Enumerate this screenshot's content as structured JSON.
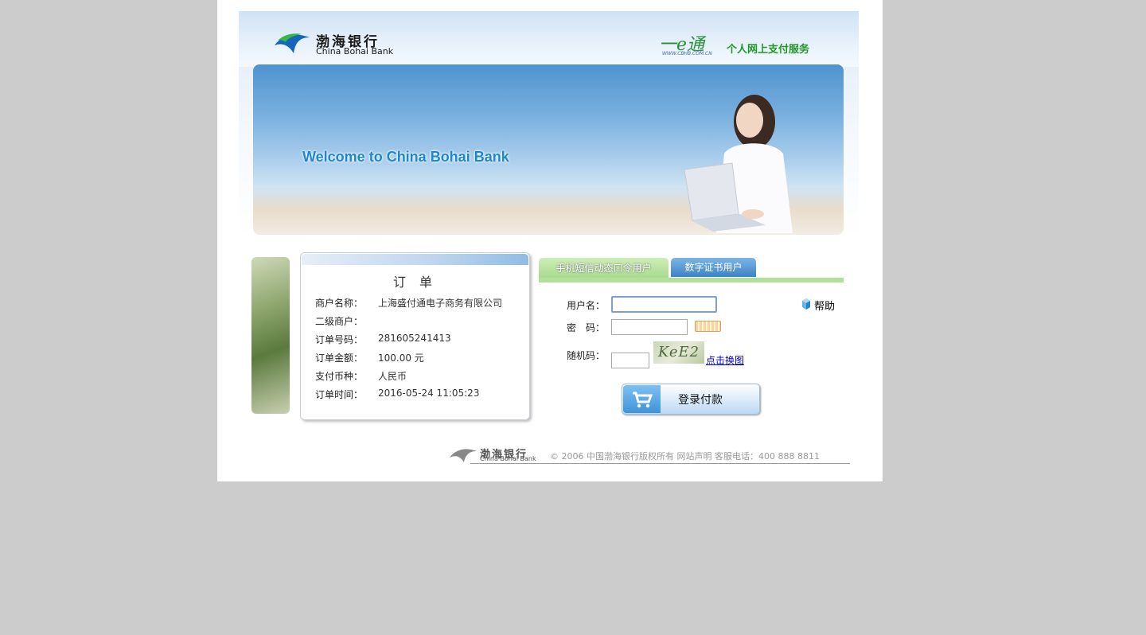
{
  "header": {
    "bank_name_cn": "渤海银行",
    "bank_name_en": "China Bohai Bank",
    "service_logo": "一e通",
    "service_logo_url_text": "WWW.CBHB.COM.CN",
    "service_title": "个人网上支付服务"
  },
  "banner": {
    "welcome_text": "Welcome to China Bohai Bank"
  },
  "order": {
    "title": "订 单",
    "rows": [
      {
        "label": "商户名称：",
        "value": "上海盛付通电子商务有限公司"
      },
      {
        "label": "二级商户：",
        "value": ""
      },
      {
        "label": "订单号码：",
        "value": "281605241413"
      },
      {
        "label": "订单金额：",
        "value": "100.00 元"
      },
      {
        "label": "支付币种：",
        "value": "人民币"
      },
      {
        "label": "订单时间：",
        "value": "2016-05-24 11:05:23"
      }
    ]
  },
  "login": {
    "tabs": [
      {
        "label": "手机短信动态口令用户",
        "active": true
      },
      {
        "label": "数字证书用户",
        "active": false
      }
    ],
    "username_label": "用户名：",
    "username_value": "",
    "password_label": "密　码：",
    "captcha_label": "随机码：",
    "captcha_image_text": "KeE2",
    "captcha_refresh_label": "点击换图",
    "help_label": "帮助",
    "submit_label": "登录付款"
  },
  "footer": {
    "logo_cn": "渤海银行",
    "logo_en": "China Bohai Bank",
    "text": "© 2006  中国渤海银行版权所有    网站声明    客服电话：400 888 8811"
  },
  "colors": {
    "page_bg": "#cccccc",
    "accent_green": "#1e9a24",
    "accent_blue": "#1d86d0",
    "link_blue": "#0000cc"
  }
}
